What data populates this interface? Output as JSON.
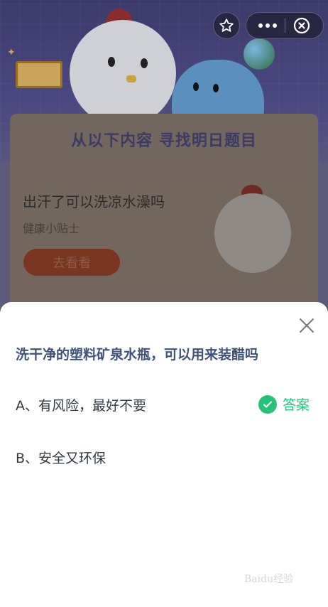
{
  "top_bar": {
    "favorite_icon": "star-outline-icon",
    "more_icon": "more-dots-icon",
    "close_icon": "close-circle-icon"
  },
  "banner": {
    "section_title": "从以下内容  寻找明日题目"
  },
  "article": {
    "title": "出汗了可以洗凉水澡吗",
    "subtitle": "健康小贴士",
    "button_label": "去看看"
  },
  "quiz": {
    "question": "洗干净的塑料矿泉水瓶，可以用来装醋吗",
    "options": [
      {
        "label": "A、有风险，最好不要",
        "is_answer": true
      },
      {
        "label": "B、安全又环保",
        "is_answer": false
      }
    ],
    "answer_label": "答案"
  },
  "watermark": "Baidu经验",
  "colors": {
    "answer_green": "#27c27a",
    "question_blue": "#3e5377",
    "overlay_dim": "#5b5a7a"
  }
}
